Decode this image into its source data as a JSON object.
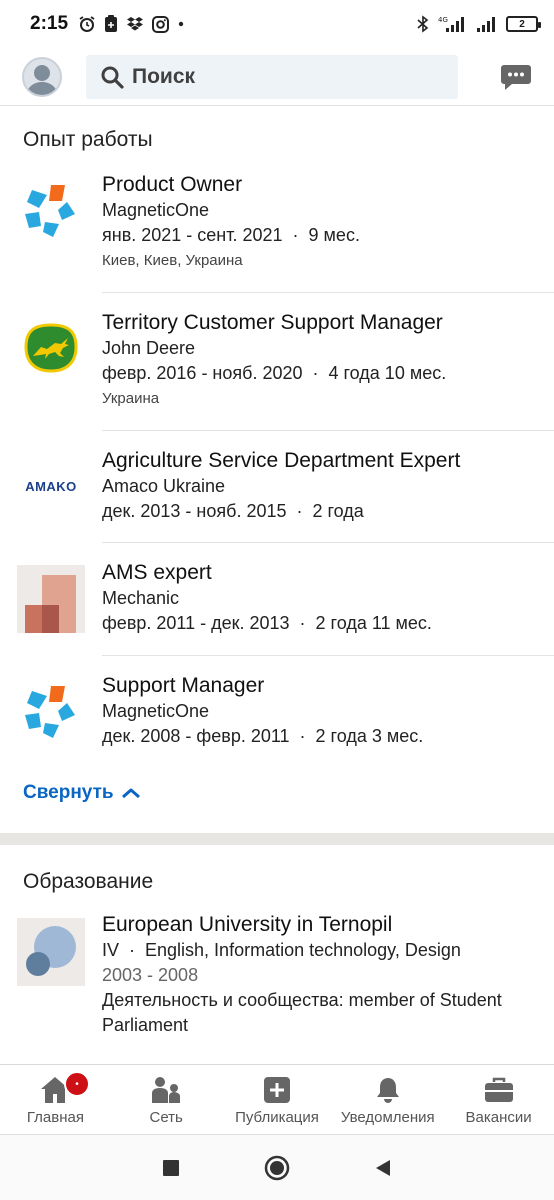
{
  "status_bar": {
    "time": "2:15",
    "battery": "2",
    "network": "4G"
  },
  "search": {
    "placeholder": "Поиск"
  },
  "experience": {
    "title": "Опыт работы",
    "items": [
      {
        "title": "Product Owner",
        "company": "MagneticOne",
        "dates": "янв. 2021 - сент. 2021",
        "duration": "9 мес.",
        "location": "Киев, Киев, Украина"
      },
      {
        "title": "Territory Customer Support Manager",
        "company": "John Deere",
        "dates": "февр. 2016 - нояб. 2020",
        "duration": "4 года 10 мес.",
        "location": "Украина"
      },
      {
        "title": "Agriculture Service Department Expert",
        "company": "Amaco Ukraine",
        "dates": "дек. 2013 - нояб. 2015",
        "duration": "2 года",
        "logo_text": "AMAKO"
      },
      {
        "title": "AMS expert",
        "company": "Mechanic",
        "dates": "февр. 2011 - дек. 2013",
        "duration": "2 года 11 мес."
      },
      {
        "title": "Support Manager",
        "company": "MagneticOne",
        "dates": "дек. 2008 - февр. 2011",
        "duration": "2 года 3 мес."
      }
    ],
    "collapse_label": "Свернуть"
  },
  "education": {
    "title": "Образование",
    "items": [
      {
        "school": "European University in Ternopil",
        "degree": "IV",
        "field": "English, Information technology, Design",
        "years": "2003 - 2008",
        "activities": "Деятельность и сообщества: member of Student Parliament"
      }
    ]
  },
  "bottom_nav": [
    {
      "label": "Главная",
      "icon": "home-icon"
    },
    {
      "label": "Сеть",
      "icon": "network-icon"
    },
    {
      "label": "Публикация",
      "icon": "post-icon"
    },
    {
      "label": "Уведомления",
      "icon": "bell-icon"
    },
    {
      "label": "Вакансии",
      "icon": "briefcase-icon"
    }
  ],
  "colors": {
    "accent": "#0a66c2",
    "badge": "#cc1016",
    "search_bg": "#eef3f8"
  }
}
